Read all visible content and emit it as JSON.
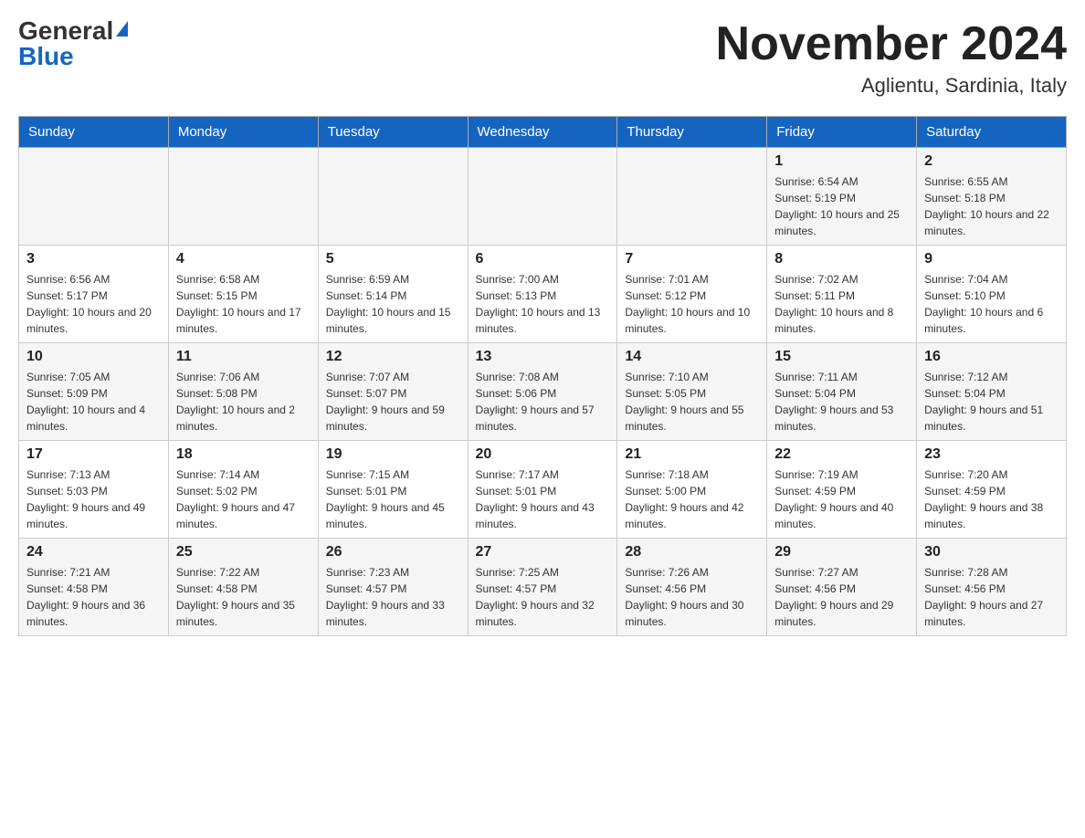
{
  "header": {
    "logo_general": "General",
    "logo_blue": "Blue",
    "month_title": "November 2024",
    "location": "Aglientu, Sardinia, Italy"
  },
  "days_of_week": [
    "Sunday",
    "Monday",
    "Tuesday",
    "Wednesday",
    "Thursday",
    "Friday",
    "Saturday"
  ],
  "weeks": [
    {
      "days": [
        {
          "number": "",
          "info": ""
        },
        {
          "number": "",
          "info": ""
        },
        {
          "number": "",
          "info": ""
        },
        {
          "number": "",
          "info": ""
        },
        {
          "number": "",
          "info": ""
        },
        {
          "number": "1",
          "info": "Sunrise: 6:54 AM\nSunset: 5:19 PM\nDaylight: 10 hours and 25 minutes."
        },
        {
          "number": "2",
          "info": "Sunrise: 6:55 AM\nSunset: 5:18 PM\nDaylight: 10 hours and 22 minutes."
        }
      ]
    },
    {
      "days": [
        {
          "number": "3",
          "info": "Sunrise: 6:56 AM\nSunset: 5:17 PM\nDaylight: 10 hours and 20 minutes."
        },
        {
          "number": "4",
          "info": "Sunrise: 6:58 AM\nSunset: 5:15 PM\nDaylight: 10 hours and 17 minutes."
        },
        {
          "number": "5",
          "info": "Sunrise: 6:59 AM\nSunset: 5:14 PM\nDaylight: 10 hours and 15 minutes."
        },
        {
          "number": "6",
          "info": "Sunrise: 7:00 AM\nSunset: 5:13 PM\nDaylight: 10 hours and 13 minutes."
        },
        {
          "number": "7",
          "info": "Sunrise: 7:01 AM\nSunset: 5:12 PM\nDaylight: 10 hours and 10 minutes."
        },
        {
          "number": "8",
          "info": "Sunrise: 7:02 AM\nSunset: 5:11 PM\nDaylight: 10 hours and 8 minutes."
        },
        {
          "number": "9",
          "info": "Sunrise: 7:04 AM\nSunset: 5:10 PM\nDaylight: 10 hours and 6 minutes."
        }
      ]
    },
    {
      "days": [
        {
          "number": "10",
          "info": "Sunrise: 7:05 AM\nSunset: 5:09 PM\nDaylight: 10 hours and 4 minutes."
        },
        {
          "number": "11",
          "info": "Sunrise: 7:06 AM\nSunset: 5:08 PM\nDaylight: 10 hours and 2 minutes."
        },
        {
          "number": "12",
          "info": "Sunrise: 7:07 AM\nSunset: 5:07 PM\nDaylight: 9 hours and 59 minutes."
        },
        {
          "number": "13",
          "info": "Sunrise: 7:08 AM\nSunset: 5:06 PM\nDaylight: 9 hours and 57 minutes."
        },
        {
          "number": "14",
          "info": "Sunrise: 7:10 AM\nSunset: 5:05 PM\nDaylight: 9 hours and 55 minutes."
        },
        {
          "number": "15",
          "info": "Sunrise: 7:11 AM\nSunset: 5:04 PM\nDaylight: 9 hours and 53 minutes."
        },
        {
          "number": "16",
          "info": "Sunrise: 7:12 AM\nSunset: 5:04 PM\nDaylight: 9 hours and 51 minutes."
        }
      ]
    },
    {
      "days": [
        {
          "number": "17",
          "info": "Sunrise: 7:13 AM\nSunset: 5:03 PM\nDaylight: 9 hours and 49 minutes."
        },
        {
          "number": "18",
          "info": "Sunrise: 7:14 AM\nSunset: 5:02 PM\nDaylight: 9 hours and 47 minutes."
        },
        {
          "number": "19",
          "info": "Sunrise: 7:15 AM\nSunset: 5:01 PM\nDaylight: 9 hours and 45 minutes."
        },
        {
          "number": "20",
          "info": "Sunrise: 7:17 AM\nSunset: 5:01 PM\nDaylight: 9 hours and 43 minutes."
        },
        {
          "number": "21",
          "info": "Sunrise: 7:18 AM\nSunset: 5:00 PM\nDaylight: 9 hours and 42 minutes."
        },
        {
          "number": "22",
          "info": "Sunrise: 7:19 AM\nSunset: 4:59 PM\nDaylight: 9 hours and 40 minutes."
        },
        {
          "number": "23",
          "info": "Sunrise: 7:20 AM\nSunset: 4:59 PM\nDaylight: 9 hours and 38 minutes."
        }
      ]
    },
    {
      "days": [
        {
          "number": "24",
          "info": "Sunrise: 7:21 AM\nSunset: 4:58 PM\nDaylight: 9 hours and 36 minutes."
        },
        {
          "number": "25",
          "info": "Sunrise: 7:22 AM\nSunset: 4:58 PM\nDaylight: 9 hours and 35 minutes."
        },
        {
          "number": "26",
          "info": "Sunrise: 7:23 AM\nSunset: 4:57 PM\nDaylight: 9 hours and 33 minutes."
        },
        {
          "number": "27",
          "info": "Sunrise: 7:25 AM\nSunset: 4:57 PM\nDaylight: 9 hours and 32 minutes."
        },
        {
          "number": "28",
          "info": "Sunrise: 7:26 AM\nSunset: 4:56 PM\nDaylight: 9 hours and 30 minutes."
        },
        {
          "number": "29",
          "info": "Sunrise: 7:27 AM\nSunset: 4:56 PM\nDaylight: 9 hours and 29 minutes."
        },
        {
          "number": "30",
          "info": "Sunrise: 7:28 AM\nSunset: 4:56 PM\nDaylight: 9 hours and 27 minutes."
        }
      ]
    }
  ]
}
